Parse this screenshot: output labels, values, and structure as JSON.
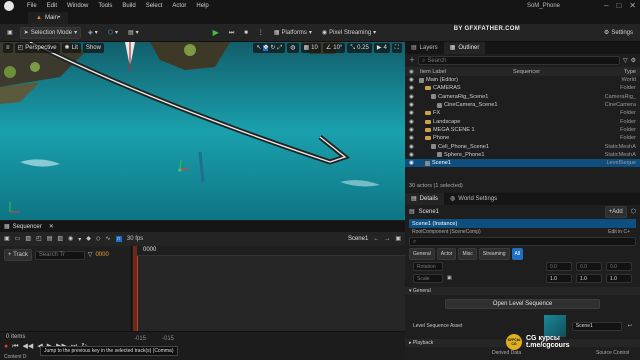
{
  "menubar": {
    "items": [
      "File",
      "Edit",
      "Window",
      "Tools",
      "Build",
      "Select",
      "Actor",
      "Help"
    ],
    "window_title": "SoM_Phone"
  },
  "tabs": {
    "main_tab": "Main•"
  },
  "watermark_top": "BY GFXFATHER.COM",
  "toolbar": {
    "save_icon": "save-icon",
    "mode": "Selection Mode",
    "platforms": "Platforms",
    "pixel_streaming": "Pixel Streaming",
    "settings": "Settings"
  },
  "viewport": {
    "perspective": "Perspective",
    "lit": "Lit",
    "show": "Show",
    "snap_angle": "10°",
    "snap_scale": "0.25",
    "camera_speed": "4"
  },
  "sequencer": {
    "tab": "Sequencer",
    "fps": "30 fps",
    "scene": "Scene1",
    "add_track": "+ Track",
    "search_placeholder": "Search Tr",
    "time": "0000",
    "playhead": "0000",
    "item_count": "0 items",
    "range_start": "-015",
    "range_start2": "-015",
    "tooltip": "Jump to the previous key in the selected track(s) (Comma)",
    "content_drawer": "Content D"
  },
  "outliner": {
    "tabs": [
      "Layers",
      "Outliner"
    ],
    "search_placeholder": "Search",
    "columns": {
      "label": "Item Label",
      "sequencer": "Sequencer",
      "type": "Type"
    },
    "rows": [
      {
        "label": "Main (Editor)",
        "type": "World",
        "indent": 0,
        "kind": "world"
      },
      {
        "label": "CAMERAS",
        "type": "Folder",
        "indent": 1,
        "kind": "folder"
      },
      {
        "label": "CameraRig_Scene1",
        "type": "CameraRig_",
        "indent": 2,
        "kind": "actor"
      },
      {
        "label": "CineCamera_Scene1",
        "type": "CineCamera",
        "indent": 3,
        "kind": "actor"
      },
      {
        "label": "FX",
        "type": "Folder",
        "indent": 1,
        "kind": "folder"
      },
      {
        "label": "Landscape",
        "type": "Folder",
        "indent": 1,
        "kind": "folder"
      },
      {
        "label": "MEGA SCENE 1",
        "type": "Folder",
        "indent": 1,
        "kind": "folder"
      },
      {
        "label": "Phone",
        "type": "Folder",
        "indent": 1,
        "kind": "folder"
      },
      {
        "label": "Cell_Phone_Scene1",
        "type": "StaticMeshA",
        "indent": 2,
        "kind": "actor"
      },
      {
        "label": "Sphere_Phone1",
        "type": "StaticMeshA",
        "indent": 3,
        "kind": "actor"
      },
      {
        "label": "Scene1",
        "type": "LevelSeque",
        "indent": 1,
        "kind": "actor",
        "selected": true
      }
    ],
    "status": "30 actors (1 selected)"
  },
  "details": {
    "tabs": [
      "Details",
      "World Settings"
    ],
    "actor_name": "Scene1",
    "add_label": "+Add",
    "instance_label": "Scene1 (Instance)",
    "root_component": "RootComponent (SceneComp)",
    "edit_in": "Edit in C+",
    "filter_tabs": [
      "General",
      "Actor",
      "Misc",
      "Streaming",
      "All"
    ],
    "active_filter": "All",
    "rotation_label": "Rotation",
    "rotation_values": [
      "0.0",
      "0.0",
      "0.0"
    ],
    "scale_label": "Scale",
    "scale_values": [
      "1.0",
      "1.0",
      "1.0"
    ],
    "section_general": "General",
    "open_sequence": "Open Level Sequence",
    "asset_label": "Level Sequence Asset",
    "asset_value": "Scene1",
    "section_playback": "Playback",
    "derived_data": "Derived Data",
    "source_control": "Source Control"
  },
  "watermark_bottom": {
    "line1": "CG курсы",
    "line2": "t.me/cgcours",
    "badge": "КУРСЫ CG"
  },
  "colors": {
    "accent": "#1f6fc0",
    "selection": "#0f4f80",
    "play": "#3fbf3f"
  }
}
